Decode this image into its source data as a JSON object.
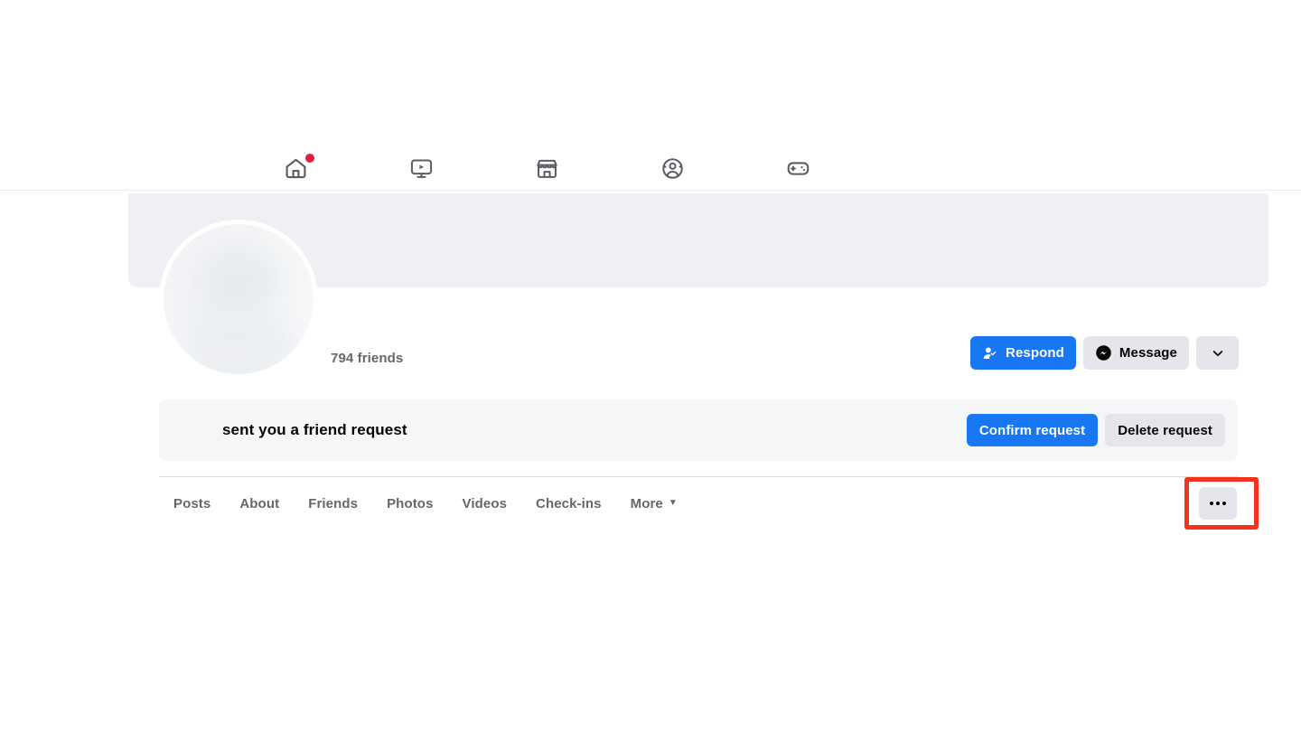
{
  "topnav": {
    "items": [
      {
        "name": "home",
        "icon": "home-icon",
        "has_badge": true
      },
      {
        "name": "watch",
        "icon": "video-icon",
        "has_badge": false
      },
      {
        "name": "marketplace",
        "icon": "marketplace-icon",
        "has_badge": false
      },
      {
        "name": "groups",
        "icon": "groups-icon",
        "has_badge": false
      },
      {
        "name": "gaming",
        "icon": "gaming-controller-icon",
        "has_badge": false
      }
    ]
  },
  "profile": {
    "friend_count": "794 friends",
    "avatar_alt": "profile-picture",
    "actions": {
      "respond_label": "Respond",
      "respond_icon": "person-check-icon",
      "message_label": "Message",
      "message_icon": "messenger-icon",
      "more_options_icon": "chevron-down-icon"
    }
  },
  "friend_request": {
    "text": "sent you a friend request",
    "confirm_label": "Confirm request",
    "delete_label": "Delete request"
  },
  "tabs": [
    {
      "label": "Posts",
      "has_caret": false
    },
    {
      "label": "About",
      "has_caret": false
    },
    {
      "label": "Friends",
      "has_caret": false
    },
    {
      "label": "Photos",
      "has_caret": false
    },
    {
      "label": "Videos",
      "has_caret": false
    },
    {
      "label": "Check-ins",
      "has_caret": false
    },
    {
      "label": "More",
      "has_caret": true
    }
  ],
  "more_menu": {
    "icon": "ellipsis-icon",
    "highlight_color": "#f4321e"
  },
  "colors": {
    "primary_blue": "#1877f2",
    "secondary_grey": "#e4e6eb",
    "badge_red": "#e41e3f",
    "cover_grey": "#eef0f3",
    "text_primary": "#050505",
    "text_secondary": "#65676b"
  }
}
